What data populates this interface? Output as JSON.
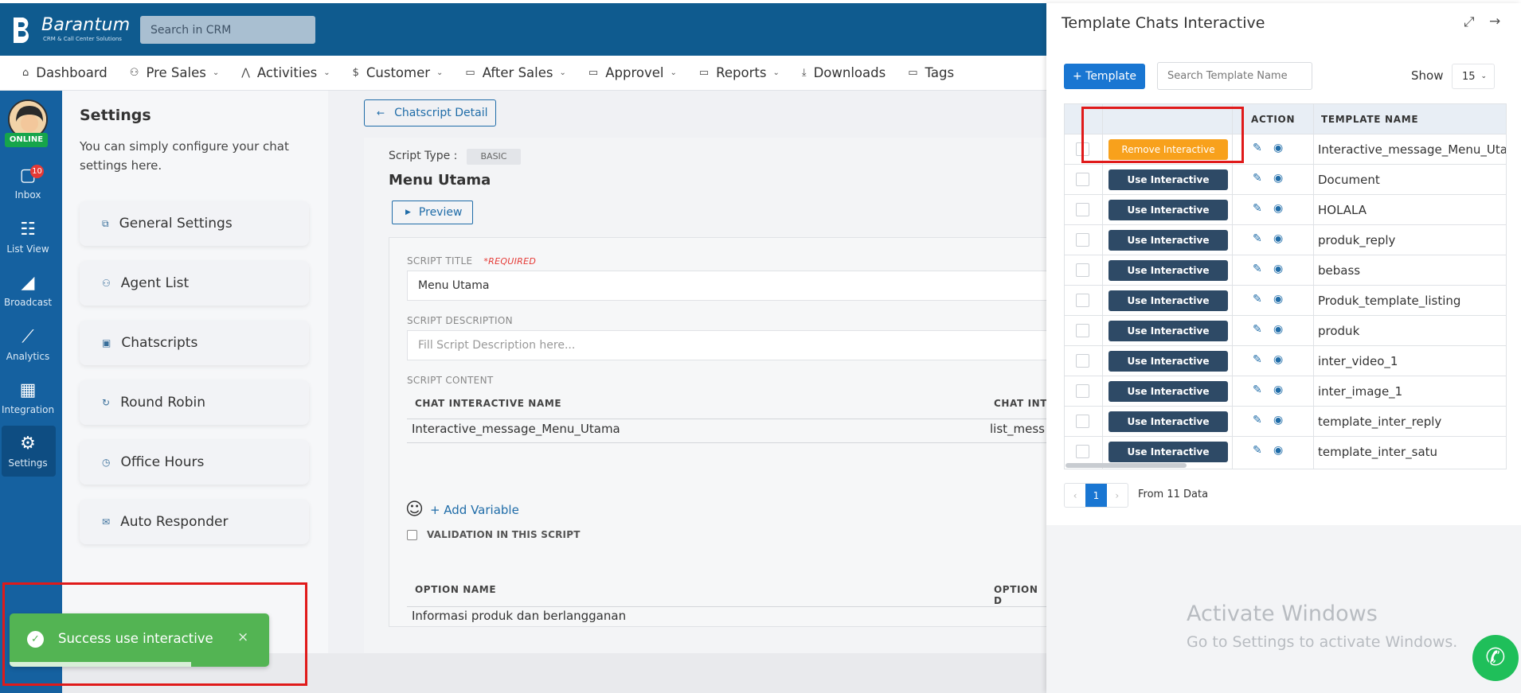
{
  "header": {
    "logo_title": "Barantum",
    "logo_subtitle": "CRM & Call Center Solutions",
    "search_placeholder": "Search in CRM"
  },
  "nav": [
    {
      "label": "Dashboard",
      "icon": "home-icon",
      "glyph": "⌂",
      "dropdown": false
    },
    {
      "label": "Pre Sales",
      "icon": "users-icon",
      "glyph": "⚇",
      "dropdown": true
    },
    {
      "label": "Activities",
      "icon": "activity-icon",
      "glyph": "⋀",
      "dropdown": true
    },
    {
      "label": "Customer",
      "icon": "dollar-icon",
      "glyph": "$",
      "dropdown": true
    },
    {
      "label": "After Sales",
      "icon": "folder-icon",
      "glyph": "▭",
      "dropdown": true
    },
    {
      "label": "Approvel",
      "icon": "folder-icon",
      "glyph": "▭",
      "dropdown": true
    },
    {
      "label": "Reports",
      "icon": "folder-icon",
      "glyph": "▭",
      "dropdown": true
    },
    {
      "label": "Downloads",
      "icon": "download-icon",
      "glyph": "⤓",
      "dropdown": false
    },
    {
      "label": "Tags",
      "icon": "folder-icon",
      "glyph": "▭",
      "dropdown": false
    }
  ],
  "sidebar": {
    "status": "ONLINE",
    "inbox_badge": "10",
    "items": [
      {
        "label": "Inbox",
        "icon": "chat-icon",
        "glyph": "▢"
      },
      {
        "label": "List View",
        "icon": "list-icon",
        "glyph": "☷"
      },
      {
        "label": "Broadcast",
        "icon": "megaphone-icon",
        "glyph": "◢"
      },
      {
        "label": "Analytics",
        "icon": "chart-icon",
        "glyph": "⟋"
      },
      {
        "label": "Integration",
        "icon": "grid-icon",
        "glyph": "▦"
      },
      {
        "label": "Settings",
        "icon": "gear-icon",
        "glyph": "⚙"
      }
    ]
  },
  "settings": {
    "title": "Settings",
    "description": "You can simply configure your chat settings here.",
    "menu": [
      {
        "label": "General Settings",
        "glyph": "⧉"
      },
      {
        "label": "Agent List",
        "glyph": "⚇"
      },
      {
        "label": "Chatscripts",
        "glyph": "▣"
      },
      {
        "label": "Round Robin",
        "glyph": "↻"
      },
      {
        "label": "Office Hours",
        "glyph": "◷"
      },
      {
        "label": "Auto Responder",
        "glyph": "✉"
      }
    ]
  },
  "main": {
    "back_button": "Chatscript Detail",
    "script_type_label": "Script Type :",
    "script_type_value": "BASIC",
    "script_name": "Menu Utama",
    "preview_button": "Preview",
    "script_title_label": "SCRIPT TITLE",
    "required_label": "*REQUIRED",
    "script_title_value": "Menu Utama",
    "script_description_label": "SCRIPT DESCRIPTION",
    "script_description_placeholder": "Fill Script Description here...",
    "script_content_label": "SCRIPT CONTENT",
    "col_interactive_name": "CHAT INTERACTIVE NAME",
    "col_interactive_type": "CHAT INT",
    "row_interactive_name": "Interactive_message_Menu_Utama",
    "row_interactive_type": "list_mess",
    "add_variable": "+ Add Variable",
    "validation_label": "VALIDATION IN THIS SCRIPT",
    "col_option_name": "OPTION NAME",
    "col_option_d": "OPTION D",
    "option_row": "Informasi produk dan berlangganan"
  },
  "toast": {
    "message": "Success use interactive",
    "close": "×"
  },
  "drawer": {
    "title": "Template Chats Interactive",
    "add_button": "+ Template",
    "search_placeholder": "Search Template Name",
    "show_label": "Show",
    "show_value": "15",
    "col_action": "ACTION",
    "col_template_name": "TEMPLATE NAME",
    "rows": [
      {
        "button": "Remove Interactive",
        "active": true,
        "name": "Interactive_message_Menu_Utama"
      },
      {
        "button": "Use Interactive",
        "active": false,
        "name": "Document"
      },
      {
        "button": "Use Interactive",
        "active": false,
        "name": "HOLALA"
      },
      {
        "button": "Use Interactive",
        "active": false,
        "name": "produk_reply"
      },
      {
        "button": "Use Interactive",
        "active": false,
        "name": "bebass"
      },
      {
        "button": "Use Interactive",
        "active": false,
        "name": "Produk_template_listing"
      },
      {
        "button": "Use Interactive",
        "active": false,
        "name": "produk"
      },
      {
        "button": "Use Interactive",
        "active": false,
        "name": "inter_video_1"
      },
      {
        "button": "Use Interactive",
        "active": false,
        "name": "inter_image_1"
      },
      {
        "button": "Use Interactive",
        "active": false,
        "name": "template_inter_reply"
      },
      {
        "button": "Use Interactive",
        "active": false,
        "name": "template_inter_satu"
      }
    ],
    "pager": {
      "prev": "‹",
      "current": "1",
      "next": "›"
    },
    "from_data": "From 11 Data"
  },
  "watermark": {
    "line1": "Activate Windows",
    "line2": "Go to Settings to activate Windows."
  },
  "colors": {
    "brand": "#0f5b8f",
    "sidebar": "#1561a0",
    "primary": "#1976d2",
    "use_button": "#2e4a66",
    "remove_button": "#f8a11c",
    "success": "#53b453",
    "highlight": "#e01a1a"
  }
}
